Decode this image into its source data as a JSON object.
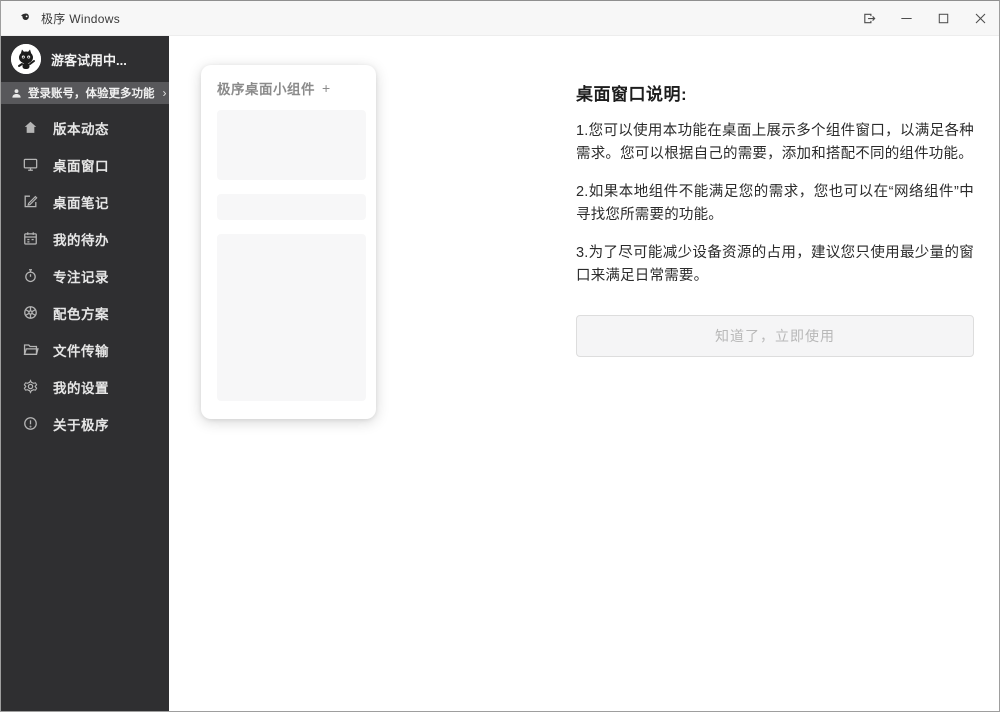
{
  "window": {
    "title": "极序 Windows"
  },
  "sidebar": {
    "user_status": "游客试用中...",
    "login_banner": {
      "label": "登录账号，体验更多功能",
      "chevron": "›"
    },
    "menu": [
      {
        "icon": "home-icon",
        "label": "版本动态"
      },
      {
        "icon": "monitor-icon",
        "label": "桌面窗口"
      },
      {
        "icon": "note-edit-icon",
        "label": "桌面笔记"
      },
      {
        "icon": "calendar-icon",
        "label": "我的待办"
      },
      {
        "icon": "stopwatch-icon",
        "label": "专注记录"
      },
      {
        "icon": "color-wheel-icon",
        "label": "配色方案"
      },
      {
        "icon": "folder-icon",
        "label": "文件传输"
      },
      {
        "icon": "gear-icon",
        "label": "我的设置"
      },
      {
        "icon": "info-icon",
        "label": "关于极序"
      }
    ]
  },
  "widget_panel": {
    "header": "极序桌面小组件",
    "add_button": "+"
  },
  "instructions": {
    "title": "桌面窗口说明:",
    "paragraphs": [
      "1.您可以使用本功能在桌面上展示多个组件窗口，以满足各种需求。您可以根据自己的需要，添加和搭配不同的组件功能。",
      "2.如果本地组件不能满足您的需求，您也可以在“网络组件”中寻找您所需要的功能。",
      "3.为了尽可能减少设备资源的占用，建议您只使用最少量的窗口来满足日常需要。"
    ],
    "confirm_button": "知道了，立即使用"
  },
  "colors": {
    "sidebar_bg": "#2f2f31",
    "login_banner_bg": "#58585b",
    "titlebar_bg": "#f7f7f7",
    "placeholder_bg": "#f7f7f8",
    "button_bg": "#f5f5f6",
    "text_primary": "#2b2b2b",
    "text_muted": "#b8b8b8"
  }
}
